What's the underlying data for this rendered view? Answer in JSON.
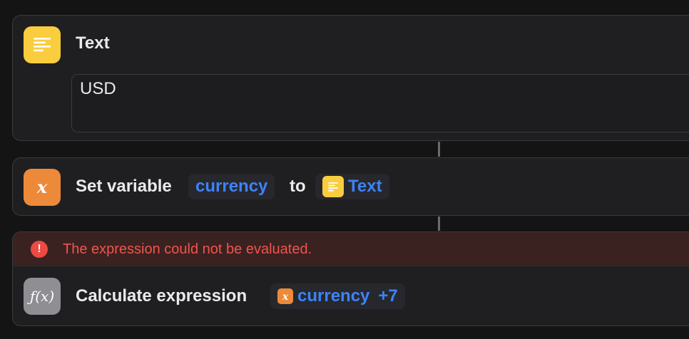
{
  "actions": {
    "text_action": {
      "title": "Text",
      "value": "USD"
    },
    "set_variable": {
      "title": "Set variable",
      "variable_name": "currency",
      "connector": "to",
      "input_name": "Text"
    },
    "calculate": {
      "error_message": "The expression could not be evaluated.",
      "title": "Calculate expression",
      "variable_name": "currency",
      "operand": "+7"
    }
  },
  "icons": {
    "text": "text-lines-icon",
    "variable": "variable-x-icon",
    "calculate": "function-fx-icon",
    "error": "exclamation-circle-icon"
  },
  "colors": {
    "text_icon": "#f9cd3d",
    "variable_icon": "#ec8a3a",
    "calc_icon": "#8e8e93",
    "token_blue": "#3e82f6",
    "error_red": "#f0544c"
  }
}
